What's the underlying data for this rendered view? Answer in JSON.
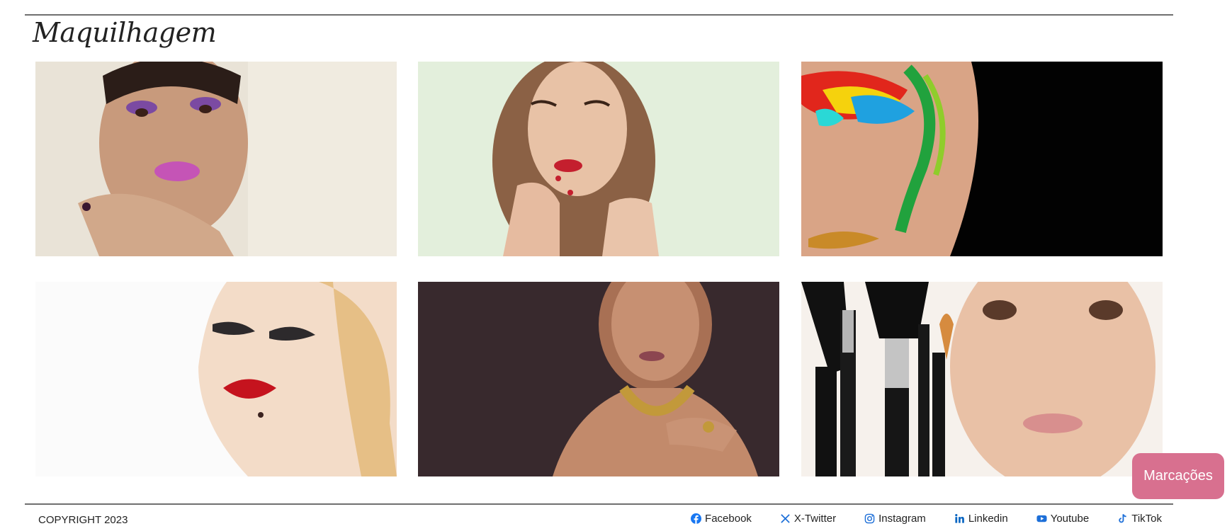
{
  "gallery": {
    "title": "Maquilhagem",
    "images": [
      {
        "name": "gallery-photo-purple-eyeshadow"
      },
      {
        "name": "gallery-photo-red-lips-curls"
      },
      {
        "name": "gallery-photo-rainbow-eye"
      },
      {
        "name": "gallery-photo-blonde-red-lips"
      },
      {
        "name": "gallery-photo-gold-necklace"
      },
      {
        "name": "gallery-photo-makeup-brushes"
      }
    ]
  },
  "footer": {
    "copyright": "COPYRIGHT 2023",
    "social": [
      {
        "label": "Facebook",
        "icon": "facebook-icon",
        "color": "#1877f2"
      },
      {
        "label": "X-Twitter",
        "icon": "x-twitter-icon",
        "color": "#1d6fd8"
      },
      {
        "label": "Instagram",
        "icon": "instagram-icon",
        "color": "#1d6fd8"
      },
      {
        "label": "Linkedin",
        "icon": "linkedin-icon",
        "color": "#0a66c2"
      },
      {
        "label": "Youtube",
        "icon": "youtube-icon",
        "color": "#1d6fd8"
      },
      {
        "label": "TikTok",
        "icon": "tiktok-icon",
        "color": "#1d6fd8"
      }
    ]
  },
  "booking": {
    "label": "Marcações",
    "color": "#d8708f"
  }
}
